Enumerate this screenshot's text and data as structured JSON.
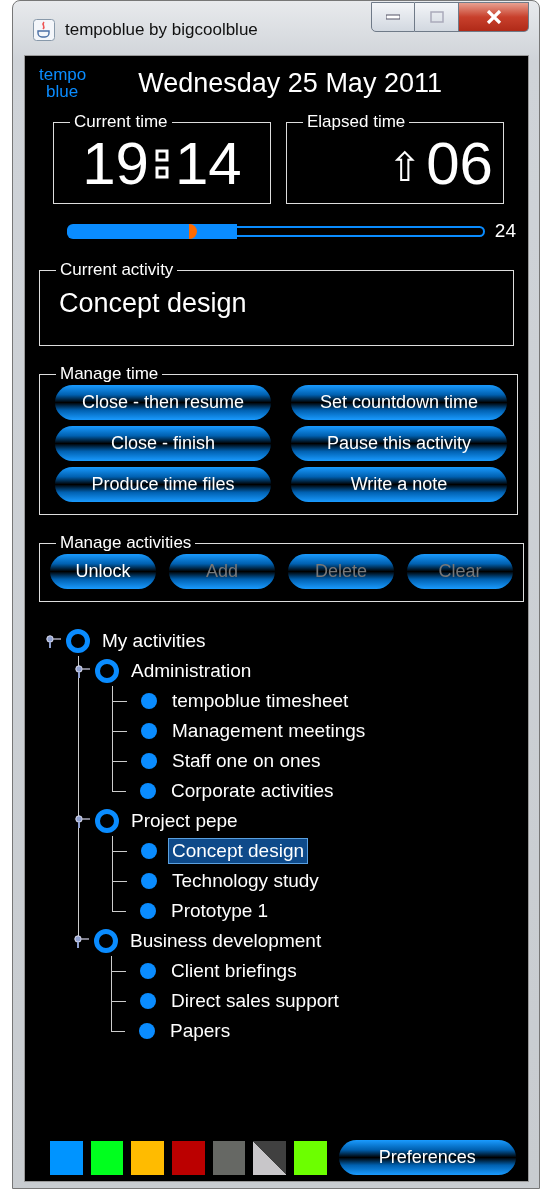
{
  "window": {
    "title": "tempoblue by bigcoolblue"
  },
  "logo": [
    "tempo",
    "blue"
  ],
  "date": "Wednesday 25 May 2011",
  "current_time": {
    "label": "Current time",
    "hours": "19",
    "minutes": "14"
  },
  "elapsed_time": {
    "label": "Elapsed time",
    "arrow": "⇧",
    "value": "06"
  },
  "progress": {
    "level": 0.41,
    "marker": {
      "level": 0.29
    },
    "reading": "24"
  },
  "current_activity": {
    "label": "Current activity",
    "value": "Concept design"
  },
  "manage_time": {
    "label": "Manage time",
    "buttons": [
      {
        "label": "Close - then resume",
        "disabled": false
      },
      {
        "label": "Set countdown time",
        "disabled": false
      },
      {
        "label": "Close - finish",
        "disabled": false
      },
      {
        "label": "Pause this activity",
        "disabled": false
      },
      {
        "label": "Produce time files",
        "disabled": false
      },
      {
        "label": "Write a note",
        "disabled": false
      }
    ]
  },
  "manage_activities": {
    "label": "Manage activities",
    "buttons": [
      {
        "label": "Unlock",
        "disabled": false
      },
      {
        "label": "Add",
        "disabled": true
      },
      {
        "label": "Delete",
        "disabled": true
      },
      {
        "label": "Clear",
        "disabled": true
      }
    ]
  },
  "tree": [
    {
      "label": "My activities",
      "kind": "group",
      "selected": false,
      "children": [
        {
          "label": "Administration",
          "kind": "group",
          "selected": false,
          "children": [
            {
              "label": "tempoblue timesheet",
              "kind": "activity",
              "selected": false
            },
            {
              "label": "Management meetings",
              "kind": "activity",
              "selected": false
            },
            {
              "label": "Staff one on ones",
              "kind": "activity",
              "selected": false
            },
            {
              "label": "Corporate activities",
              "kind": "activity",
              "selected": false
            }
          ]
        },
        {
          "label": "Project pepe",
          "kind": "group",
          "selected": false,
          "children": [
            {
              "label": "Concept design",
              "kind": "activity",
              "selected": true
            },
            {
              "label": "Technology study",
              "kind": "activity",
              "selected": false
            },
            {
              "label": "Prototype 1",
              "kind": "activity",
              "selected": false
            }
          ]
        },
        {
          "label": "Business development",
          "kind": "group",
          "selected": false,
          "children": [
            {
              "label": "Client briefings",
              "kind": "activity",
              "selected": false
            },
            {
              "label": "Direct sales support",
              "kind": "activity",
              "selected": false
            },
            {
              "label": "Papers",
              "kind": "activity",
              "selected": false
            }
          ]
        }
      ]
    }
  ],
  "swatches": [
    {
      "kind": "solid",
      "color": "#0094ff"
    },
    {
      "kind": "solid",
      "color": "#00ff1e"
    },
    {
      "kind": "solid",
      "color": "#ffbb00"
    },
    {
      "kind": "solid",
      "color": "#bb0000"
    },
    {
      "kind": "solid",
      "color": "#666864"
    },
    {
      "kind": "split",
      "color": "#404040"
    },
    {
      "kind": "solid",
      "color": "#6cff00"
    }
  ],
  "preferences_button": "Preferences"
}
